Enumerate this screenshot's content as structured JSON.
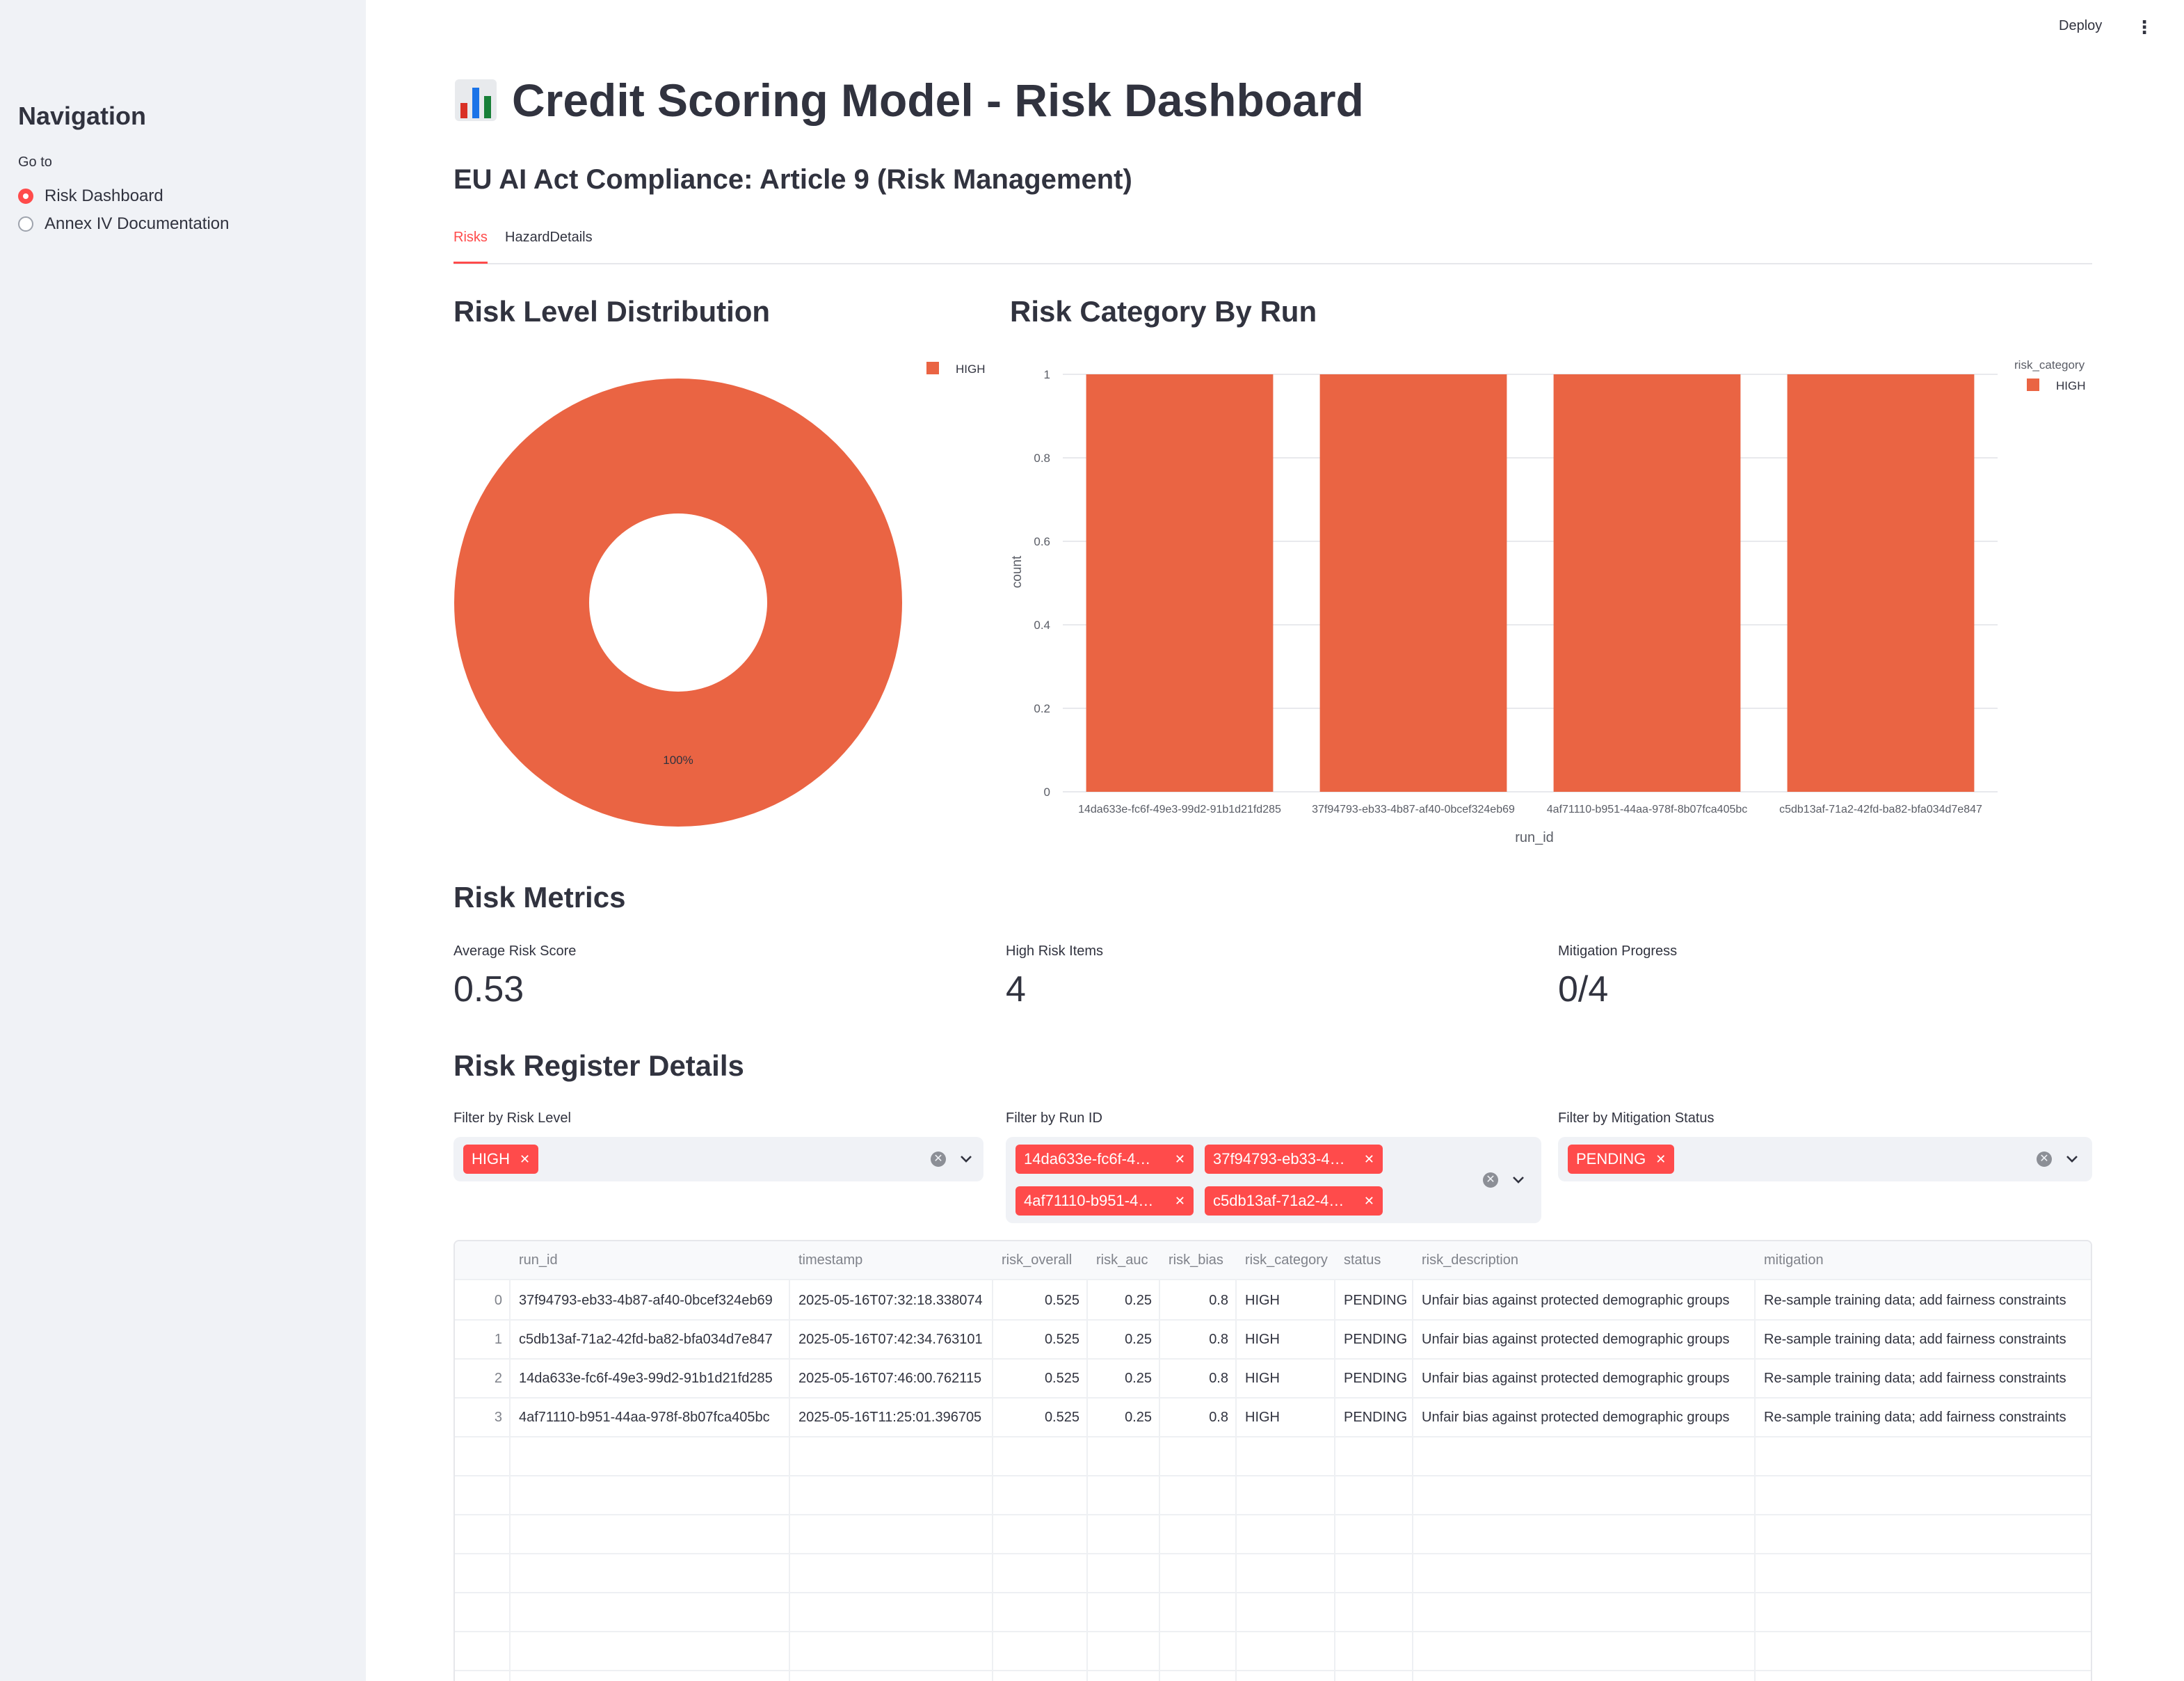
{
  "sidebar": {
    "title": "Navigation",
    "radio_label": "Go to",
    "options": [
      {
        "label": "Risk Dashboard",
        "selected": true
      },
      {
        "label": "Annex IV Documentation",
        "selected": false
      }
    ]
  },
  "header": {
    "deploy_label": "Deploy",
    "menu_icon": "kebab-menu-icon"
  },
  "main": {
    "title": "Credit Scoring Model - Risk Dashboard",
    "title_icon": "bar-chart-emoji-icon",
    "subtitle": "EU AI Act Compliance: Article 9 (Risk Management)",
    "tabs": [
      {
        "label": "Risks",
        "active": true
      },
      {
        "label": "HazardDetails",
        "active": false
      }
    ],
    "risk_level_heading": "Risk Level Distribution",
    "risk_category_heading": "Risk Category By Run",
    "metrics_heading": "Risk Metrics",
    "metrics": [
      {
        "label": "Average Risk Score",
        "value": "0.53"
      },
      {
        "label": "High Risk Items",
        "value": "4"
      },
      {
        "label": "Mitigation Progress",
        "value": "0/4"
      }
    ],
    "register_heading": "Risk Register Details",
    "filters": {
      "risk_level": {
        "label": "Filter by Risk Level",
        "chips": [
          "HIGH"
        ]
      },
      "run_id": {
        "label": "Filter by Run ID",
        "chips": [
          "14da633e-fc6f-4…",
          "37f94793-eb33-4…",
          "4af71110-b951-4…",
          "c5db13af-71a2-4…"
        ]
      },
      "mitigation": {
        "label": "Filter by Mitigation Status",
        "chips": [
          "PENDING"
        ]
      }
    },
    "table": {
      "columns": [
        "",
        "run_id",
        "timestamp",
        "risk_overall",
        "risk_auc",
        "risk_bias",
        "risk_category",
        "status",
        "risk_description",
        "mitigation"
      ],
      "rows": [
        [
          "0",
          "37f94793-eb33-4b87-af40-0bcef324eb69",
          "2025-05-16T07:32:18.338074",
          "0.525",
          "0.25",
          "0.8",
          "HIGH",
          "PENDING",
          "Unfair bias against protected demographic groups",
          "Re-sample training data; add fairness constraints"
        ],
        [
          "1",
          "c5db13af-71a2-42fd-ba82-bfa034d7e847",
          "2025-05-16T07:42:34.763101",
          "0.525",
          "0.25",
          "0.8",
          "HIGH",
          "PENDING",
          "Unfair bias against protected demographic groups",
          "Re-sample training data; add fairness constraints"
        ],
        [
          "2",
          "14da633e-fc6f-49e3-99d2-91b1d21fd285",
          "2025-05-16T07:46:00.762115",
          "0.525",
          "0.25",
          "0.8",
          "HIGH",
          "PENDING",
          "Unfair bias against protected demographic groups",
          "Re-sample training data; add fairness constraints"
        ],
        [
          "3",
          "4af71110-b951-44aa-978f-8b07fca405bc",
          "2025-05-16T11:25:01.396705",
          "0.525",
          "0.25",
          "0.8",
          "HIGH",
          "PENDING",
          "Unfair bias against protected demographic groups",
          "Re-sample training data; add fairness constraints"
        ]
      ]
    }
  },
  "colors": {
    "accent": "#ff4b4b",
    "series_high": "#ea6443",
    "sidebar_bg": "#f0f2f6"
  },
  "chart_data": [
    {
      "type": "pie",
      "hole": true,
      "labels": [
        "HIGH"
      ],
      "values": [
        100
      ],
      "slice_labels": [
        "100%"
      ],
      "legend": [
        "HIGH"
      ],
      "legend_position": "top-right"
    },
    {
      "type": "bar",
      "categories": [
        "14da633e-fc6f-49e3-99d2-91b1d21fd285",
        "37f94793-eb33-4b87-af40-0bcef324eb69",
        "4af71110-b951-44aa-978f-8b07fca405bc",
        "c5db13af-71a2-42fd-ba82-bfa034d7e847"
      ],
      "series": [
        {
          "name": "HIGH",
          "values": [
            1,
            1,
            1,
            1
          ]
        }
      ],
      "xlabel": "run_id",
      "ylabel": "count",
      "ylim": [
        0,
        1
      ],
      "yticks": [
        "0",
        "0.2",
        "0.4",
        "0.6",
        "0.8",
        "1"
      ],
      "legend_title": "risk_category",
      "legend_position": "top-right",
      "grid": true
    }
  ]
}
